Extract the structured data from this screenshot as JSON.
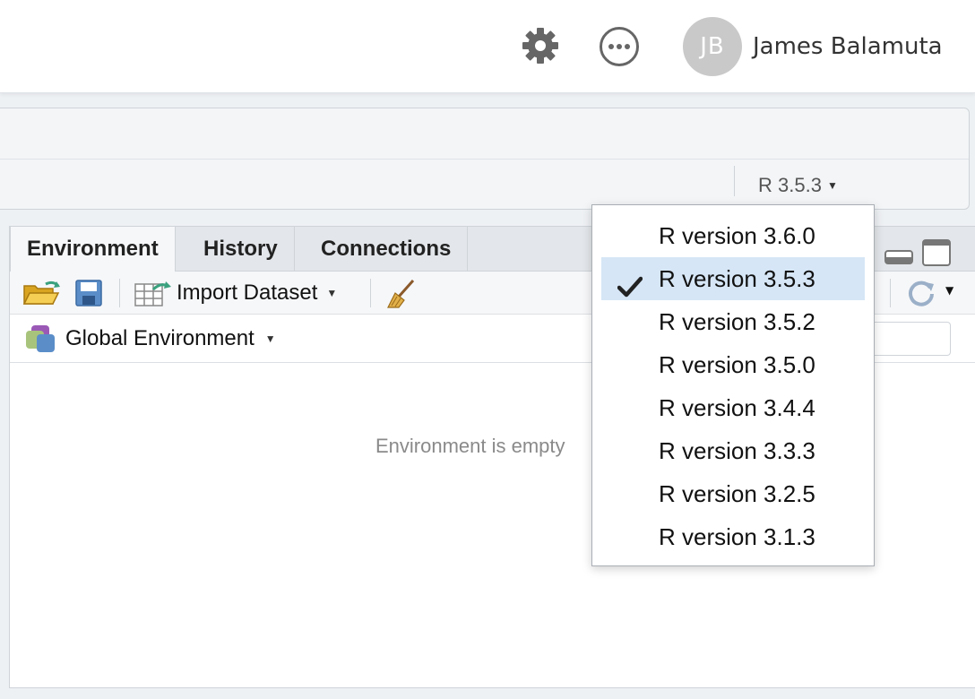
{
  "header": {
    "avatar_initials": "JB",
    "username": "James Balamuta",
    "icons": [
      "gear-icon",
      "more-icon"
    ]
  },
  "r_version_button": {
    "label": "R 3.5.3"
  },
  "pane": {
    "tabs": [
      {
        "label": "Environment",
        "active": true
      },
      {
        "label": "History",
        "active": false
      },
      {
        "label": "Connections",
        "active": false
      }
    ],
    "toolbar": {
      "import_label": "Import Dataset",
      "icons": [
        "open-folder-icon",
        "save-icon",
        "import-dataset-icon",
        "broom-icon",
        "refresh-icon"
      ]
    },
    "env_selector": {
      "label": "Global Environment"
    },
    "empty_message": "Environment is empty"
  },
  "dropdown": {
    "selected_index": 1,
    "items": [
      {
        "label": "R version 3.6.0"
      },
      {
        "label": "R version 3.5.3"
      },
      {
        "label": "R version 3.5.2"
      },
      {
        "label": "R version 3.5.0"
      },
      {
        "label": "R version 3.4.4"
      },
      {
        "label": "R version 3.3.3"
      },
      {
        "label": "R version 3.2.5"
      },
      {
        "label": "R version 3.1.3"
      }
    ]
  },
  "colors": {
    "selection": "#d6e6f6",
    "avatar": "#c9c9c9",
    "icon_gray": "#666666"
  }
}
